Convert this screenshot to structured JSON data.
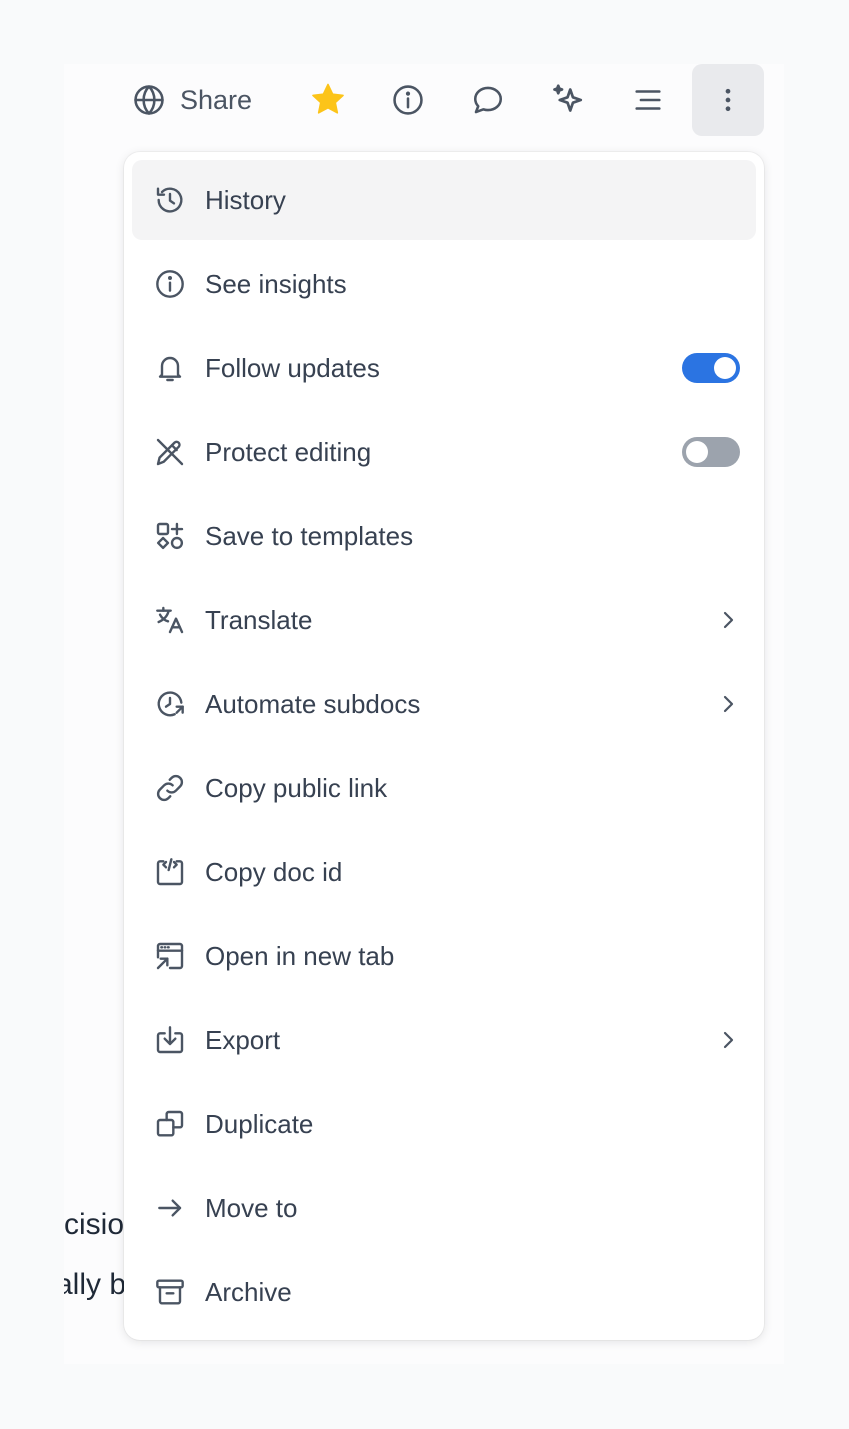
{
  "toolbar": {
    "share_label": "Share",
    "icons": [
      "globe-icon",
      "star-icon",
      "info-icon",
      "comment-icon",
      "sparkle-icon",
      "outline-icon",
      "more-icon"
    ],
    "star_color": "#fcc419"
  },
  "menu": {
    "items": [
      {
        "label": "History",
        "icon": "history-icon"
      },
      {
        "label": "See insights",
        "icon": "info-icon"
      },
      {
        "label": "Follow updates",
        "icon": "bell-icon",
        "toggle": "on"
      },
      {
        "label": "Protect editing",
        "icon": "pencil-off-icon",
        "toggle": "off"
      },
      {
        "label": "Save to templates",
        "icon": "templates-icon"
      },
      {
        "label": "Translate",
        "icon": "translate-icon",
        "submenu": true
      },
      {
        "label": "Automate subdocs",
        "icon": "automate-icon",
        "submenu": true
      },
      {
        "label": "Copy public link",
        "icon": "link-icon"
      },
      {
        "label": "Copy doc id",
        "icon": "code-icon"
      },
      {
        "label": "Open in new tab",
        "icon": "new-tab-icon"
      },
      {
        "label": "Export",
        "icon": "export-icon",
        "submenu": true
      },
      {
        "label": "Duplicate",
        "icon": "duplicate-icon"
      },
      {
        "label": "Move to",
        "icon": "arrow-right-icon"
      },
      {
        "label": "Archive",
        "icon": "archive-icon"
      }
    ]
  },
  "background_text": {
    "line1": "cisio",
    "line2": "ally b"
  },
  "colors": {
    "toggle_on": "#2b74e2",
    "toggle_off": "#9ca3ad",
    "highlight": "#f4f4f5"
  }
}
